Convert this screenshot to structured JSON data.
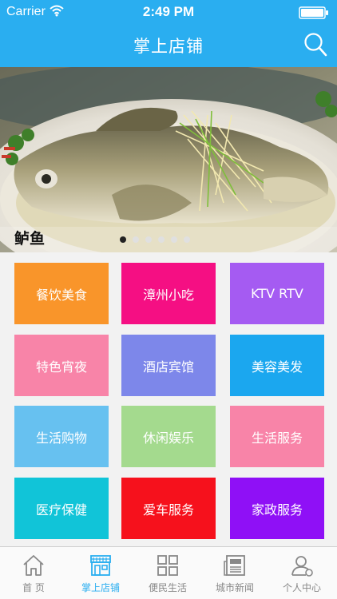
{
  "status_bar": {
    "carrier": "Carrier",
    "time": "2:49 PM"
  },
  "nav": {
    "title": "掌上店铺",
    "search_icon": "search-icon"
  },
  "banner": {
    "caption": "鲈鱼",
    "total_slides": 6,
    "active_slide": 1
  },
  "categories": [
    {
      "label": "餐饮美食",
      "color": "#f9952a"
    },
    {
      "label": "漳州小吃",
      "color": "#f50f83"
    },
    {
      "label": "KTV RTV",
      "color": "#a55bf2"
    },
    {
      "label": "特色宵夜",
      "color": "#f884a8"
    },
    {
      "label": "酒店宾馆",
      "color": "#7d87ea"
    },
    {
      "label": "美容美发",
      "color": "#1ba7ef"
    },
    {
      "label": "生活购物",
      "color": "#67c1f0"
    },
    {
      "label": "休闲娱乐",
      "color": "#a4da8e"
    },
    {
      "label": "生活服务",
      "color": "#f884a8"
    },
    {
      "label": "医疗保健",
      "color": "#11c4d8"
    },
    {
      "label": "爱车服务",
      "color": "#f6111c"
    },
    {
      "label": "家政服务",
      "color": "#8f10f6"
    }
  ],
  "tabs": [
    {
      "label": "首 页",
      "icon": "home-icon"
    },
    {
      "label": "掌上店铺",
      "icon": "storefront-icon"
    },
    {
      "label": "便民生活",
      "icon": "grid-icon"
    },
    {
      "label": "城市新闻",
      "icon": "newspaper-icon"
    },
    {
      "label": "个人中心",
      "icon": "user-icon"
    }
  ],
  "active_tab": 1,
  "colors": {
    "accent": "#2aaef0",
    "tab_inactive": "#888888"
  }
}
